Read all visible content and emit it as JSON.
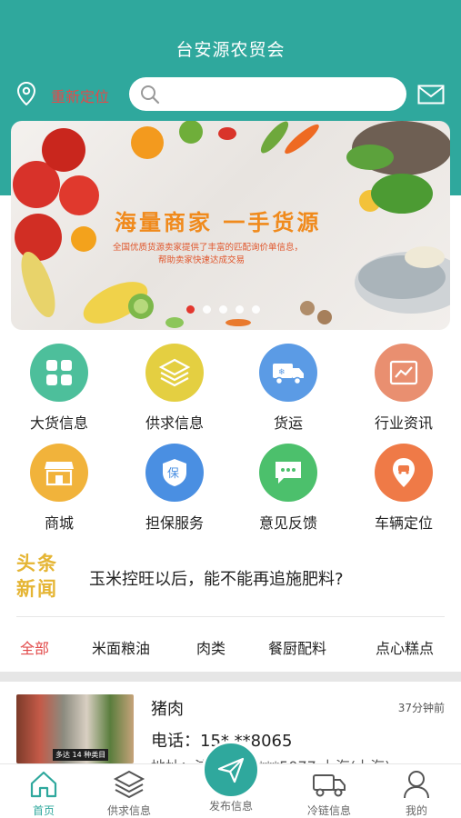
{
  "header": {
    "title": "台安源农贸会",
    "location_label": "重新定位",
    "search_placeholder": "",
    "accent": "#2fa89d"
  },
  "banner": {
    "headline": "海量商家 一手货源",
    "subtitle_line1": "全国优质货源卖家提供了丰富的匹配询价单信息，",
    "subtitle_line2": "帮助卖家快速达成交易",
    "slide_count": 5,
    "active_slide": 1
  },
  "grid": [
    {
      "label": "大货信息",
      "icon": "grid-four-icon",
      "color": "#4dbf9b"
    },
    {
      "label": "供求信息",
      "icon": "layers-icon",
      "color": "#e4cf41"
    },
    {
      "label": "货运",
      "icon": "truck-icon",
      "color": "#5b9be5"
    },
    {
      "label": "行业资讯",
      "icon": "chart-icon",
      "color": "#e98f70"
    },
    {
      "label": "商城",
      "icon": "shop-icon",
      "color": "#f1b33b"
    },
    {
      "label": "担保服务",
      "icon": "shield-icon",
      "color": "#4a8fe2"
    },
    {
      "label": "意见反馈",
      "icon": "chat-icon",
      "color": "#4cc06c"
    },
    {
      "label": "车辆定位",
      "icon": "car-pin-icon",
      "color": "#ef7a47"
    }
  ],
  "news": {
    "badge_line1": "头条",
    "badge_line2": "新闻",
    "headline": "玉米控旺以后，能不能再追施肥料?"
  },
  "tabs": [
    {
      "label": "全部",
      "active": true
    },
    {
      "label": "米面粮油",
      "active": false
    },
    {
      "label": "肉类",
      "active": false
    },
    {
      "label": "餐厨配料",
      "active": false
    },
    {
      "label": "点心糕点",
      "active": false
    }
  ],
  "listing": {
    "title": "猪肉",
    "time": "37分钟前",
    "phone": "电话：15* **8065",
    "extra": "地址：浦东新区 ***5077 上海(上海)...",
    "thumb_caption": "多达 14 种类目"
  },
  "bottom_nav": [
    {
      "label": "首页",
      "icon": "home-icon",
      "active": true
    },
    {
      "label": "供求信息",
      "icon": "layers-icon",
      "active": false
    },
    {
      "label": "发布信息",
      "icon": "send-icon",
      "active": false
    },
    {
      "label": "冷链信息",
      "icon": "truck-icon",
      "active": false
    },
    {
      "label": "我的",
      "icon": "user-icon",
      "active": false
    }
  ]
}
